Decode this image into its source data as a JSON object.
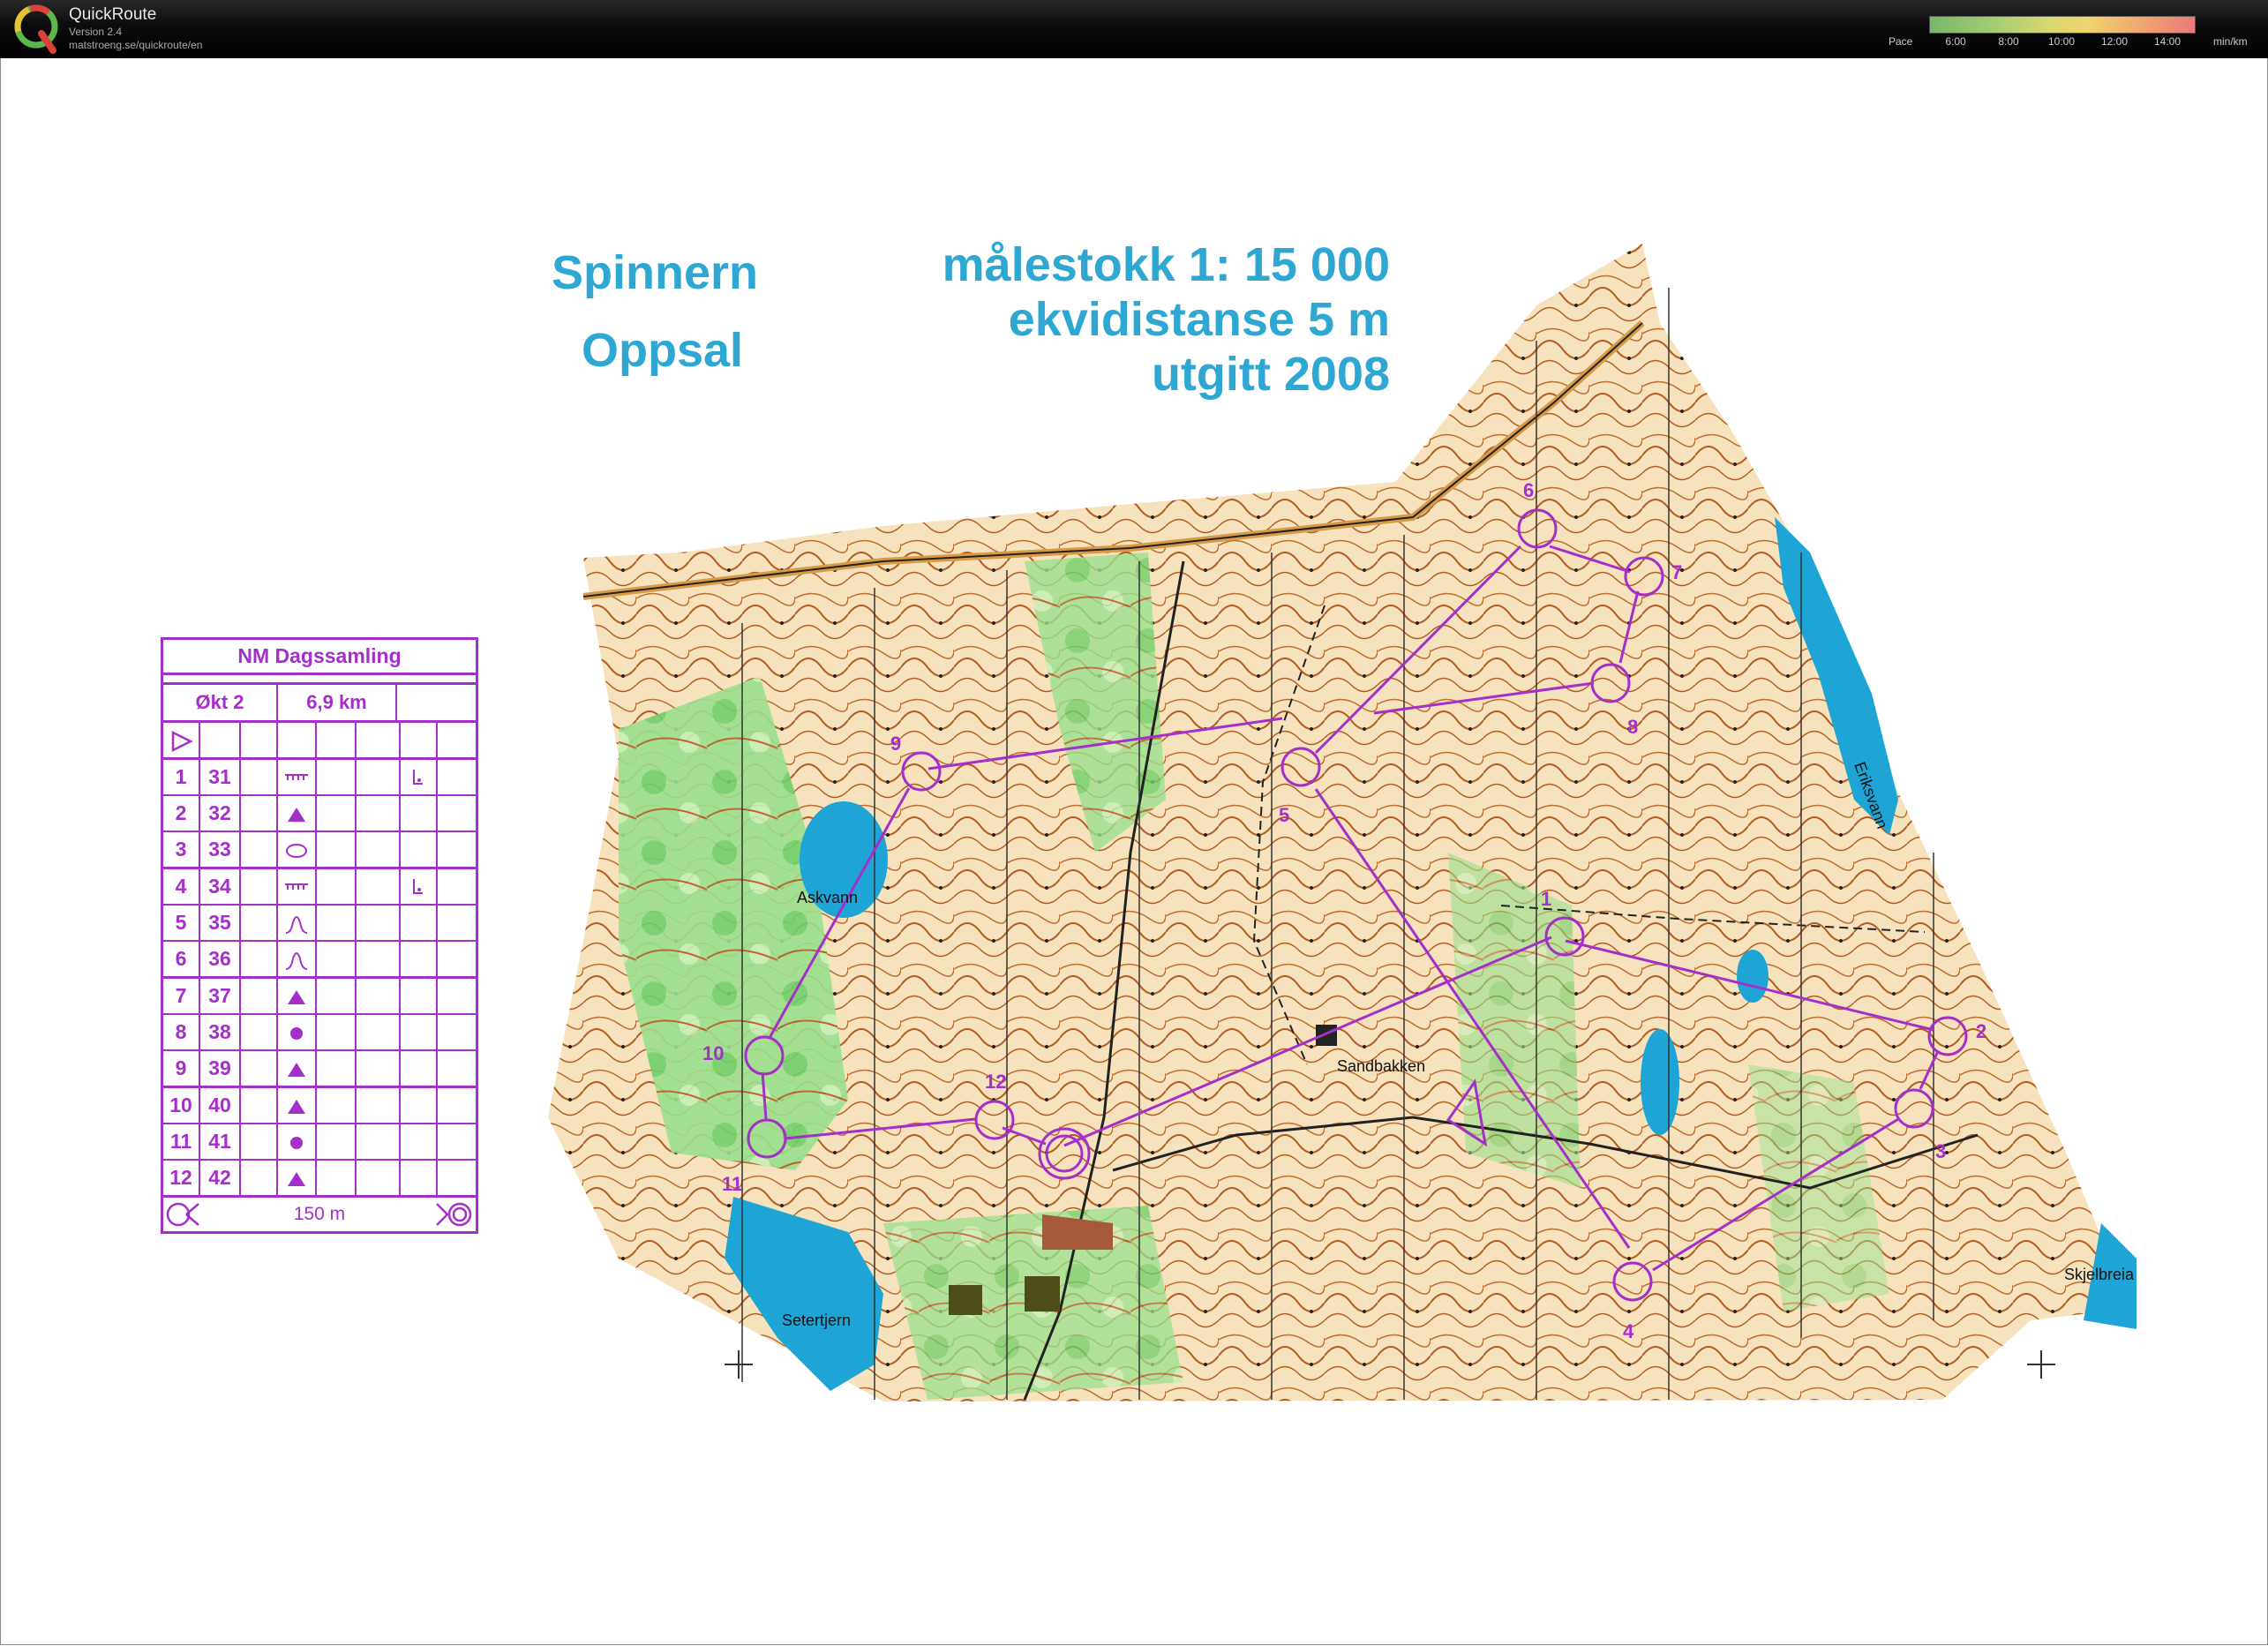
{
  "app": {
    "name": "QuickRoute",
    "version": "Version 2.4",
    "url": "matstroeng.se/quickroute/en"
  },
  "pace_legend": {
    "label": "Pace",
    "ticks": [
      "6:00",
      "8:00",
      "10:00",
      "12:00",
      "14:00"
    ],
    "unit": "min/km"
  },
  "map": {
    "name": "Spinnern",
    "area": "Oppsal",
    "scale": "målestokk  1: 15 000",
    "contour": "ekvidistanse  5 m",
    "published": "utgitt  2008",
    "place_names": [
      "Askvann",
      "Setertjern",
      "Sandbakken",
      "Eriksvann",
      "Skjelbreia"
    ],
    "colors": {
      "course": "#a52fc9",
      "water": "#1ea5d6",
      "title": "#2ea7d3",
      "open_land": "#f4d8a0",
      "green": "#7bd17a",
      "contour": "#b35a1f"
    },
    "controls": [
      "1",
      "2",
      "3",
      "4",
      "5",
      "6",
      "7",
      "8",
      "9",
      "10",
      "11",
      "12"
    ]
  },
  "control_description": {
    "event": "NM Dagssamling",
    "session": "Økt 2",
    "length": "6,9 km",
    "rows": [
      {
        "n": "1",
        "code": "31",
        "symbol": "cliff",
        "extra": "foot"
      },
      {
        "n": "2",
        "code": "32",
        "symbol": "triangle",
        "extra": ""
      },
      {
        "n": "3",
        "code": "33",
        "symbol": "ellipse",
        "extra": ""
      },
      {
        "n": "4",
        "code": "34",
        "symbol": "cliff",
        "extra": "foot"
      },
      {
        "n": "5",
        "code": "35",
        "symbol": "knoll",
        "extra": ""
      },
      {
        "n": "6",
        "code": "36",
        "symbol": "knoll",
        "extra": ""
      },
      {
        "n": "7",
        "code": "37",
        "symbol": "triangle",
        "extra": ""
      },
      {
        "n": "8",
        "code": "38",
        "symbol": "dot",
        "extra": ""
      },
      {
        "n": "9",
        "code": "39",
        "symbol": "triangle",
        "extra": ""
      },
      {
        "n": "10",
        "code": "40",
        "symbol": "triangle",
        "extra": ""
      },
      {
        "n": "11",
        "code": "41",
        "symbol": "dot",
        "extra": ""
      },
      {
        "n": "12",
        "code": "42",
        "symbol": "triangle",
        "extra": ""
      }
    ],
    "finish_distance": "150 m"
  }
}
